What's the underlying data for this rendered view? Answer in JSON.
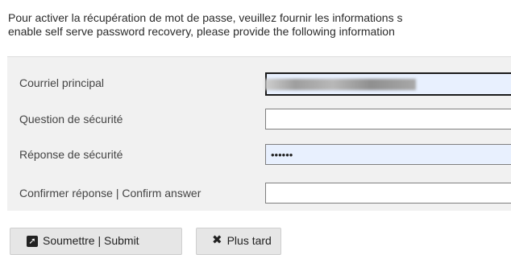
{
  "intro": {
    "line1": "Pour activer la récupération de mot de passe, veuillez fournir les informations s",
    "line2": "enable self serve password recovery, please provide the following information"
  },
  "form": {
    "fields": [
      {
        "label": "Courriel principal",
        "value": ""
      },
      {
        "label": "Question de sécurité",
        "value": ""
      },
      {
        "label": "Réponse de sécurité",
        "value": "••••••"
      },
      {
        "label": "Confirmer réponse | Confirm answer",
        "value": ""
      }
    ]
  },
  "buttons": {
    "submit_label": "Soumettre | Submit",
    "later_label": "Plus tard"
  },
  "icons": {
    "submit": "arrow-in-box-icon",
    "later": "close-icon"
  }
}
